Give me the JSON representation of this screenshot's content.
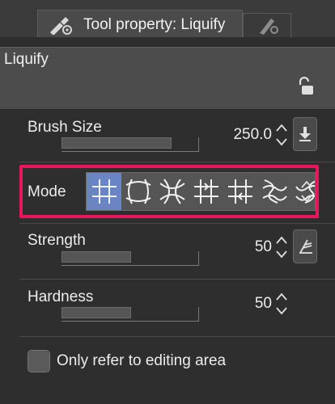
{
  "tabs": [
    {
      "label": "Tool property: Liquify",
      "icon": "tool-property-icon",
      "active": true
    },
    {
      "label": "",
      "icon": "brush-property-icon",
      "active": false
    }
  ],
  "tool": {
    "name": "Liquify",
    "lock_icon": "unlock-icon"
  },
  "properties": {
    "brush_size": {
      "label": "Brush Size",
      "value": "250.0",
      "slider_fraction": 0.8
    },
    "mode": {
      "label": "Mode",
      "options": [
        "mode-push",
        "mode-expand",
        "mode-pinch",
        "mode-push-left",
        "mode-push-right",
        "mode-twist-left",
        "mode-twist-right"
      ],
      "selected": "mode-push"
    },
    "strength": {
      "label": "Strength",
      "value": "50",
      "slider_fraction": 0.5
    },
    "hardness": {
      "label": "Hardness",
      "value": "50",
      "slider_fraction": 0.5
    }
  },
  "only_editing_area": {
    "label": "Only refer to editing area",
    "checked": false
  },
  "colors": {
    "accent_highlight": "#e8175d",
    "selected_mode": "#6b84c2",
    "panel_bg": "#2e2e2e"
  }
}
